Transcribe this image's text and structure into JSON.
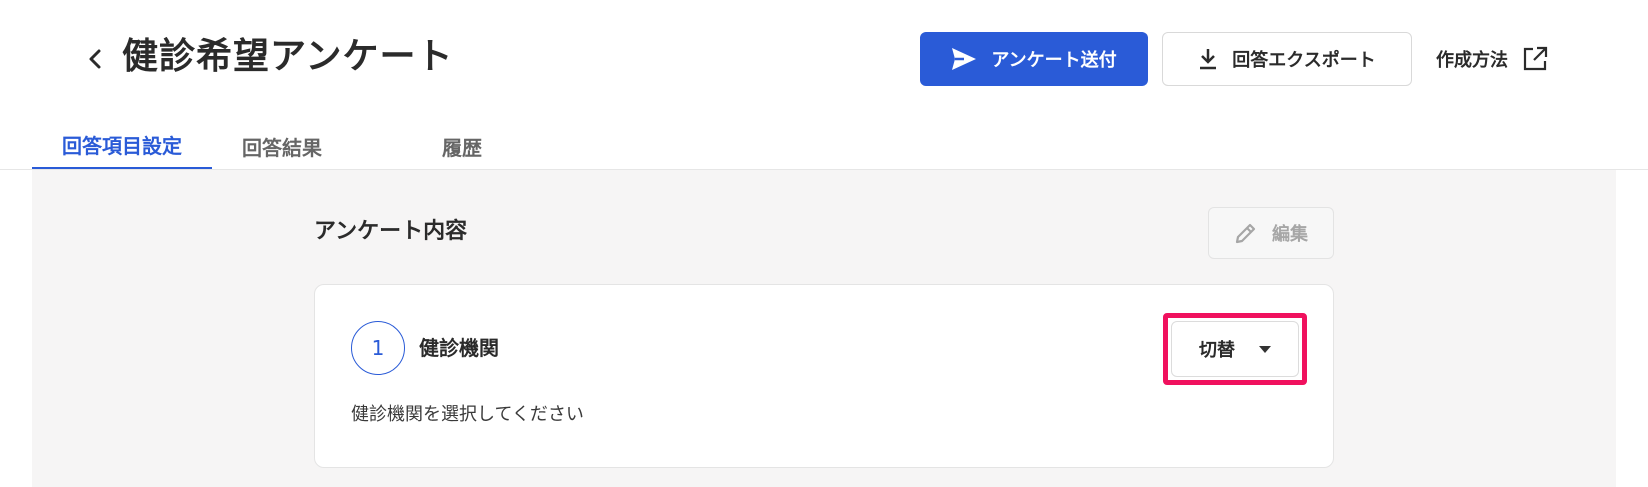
{
  "header": {
    "title": "健診希望アンケート",
    "send_label": "アンケート送付",
    "export_label": "回答エクスポート",
    "howto_label": "作成方法"
  },
  "tabs": [
    {
      "label": "回答項目設定",
      "active": true
    },
    {
      "label": "回答結果",
      "active": false
    },
    {
      "label": "履歴",
      "active": false
    }
  ],
  "section": {
    "title": "アンケート内容",
    "edit_label": "編集"
  },
  "question": {
    "number": "1",
    "title": "健診機関",
    "description": "健診機関を選択してください",
    "switch_label": "切替"
  },
  "colors": {
    "accent": "#2a5bd7",
    "highlight": "#f0115e",
    "content_bg": "#f6f5f5"
  },
  "icons": {
    "back": "chevron-left-icon",
    "send": "send-icon",
    "export": "download-icon",
    "howto": "external-link-icon",
    "edit": "pencil-icon",
    "switch": "caret-down-icon"
  }
}
